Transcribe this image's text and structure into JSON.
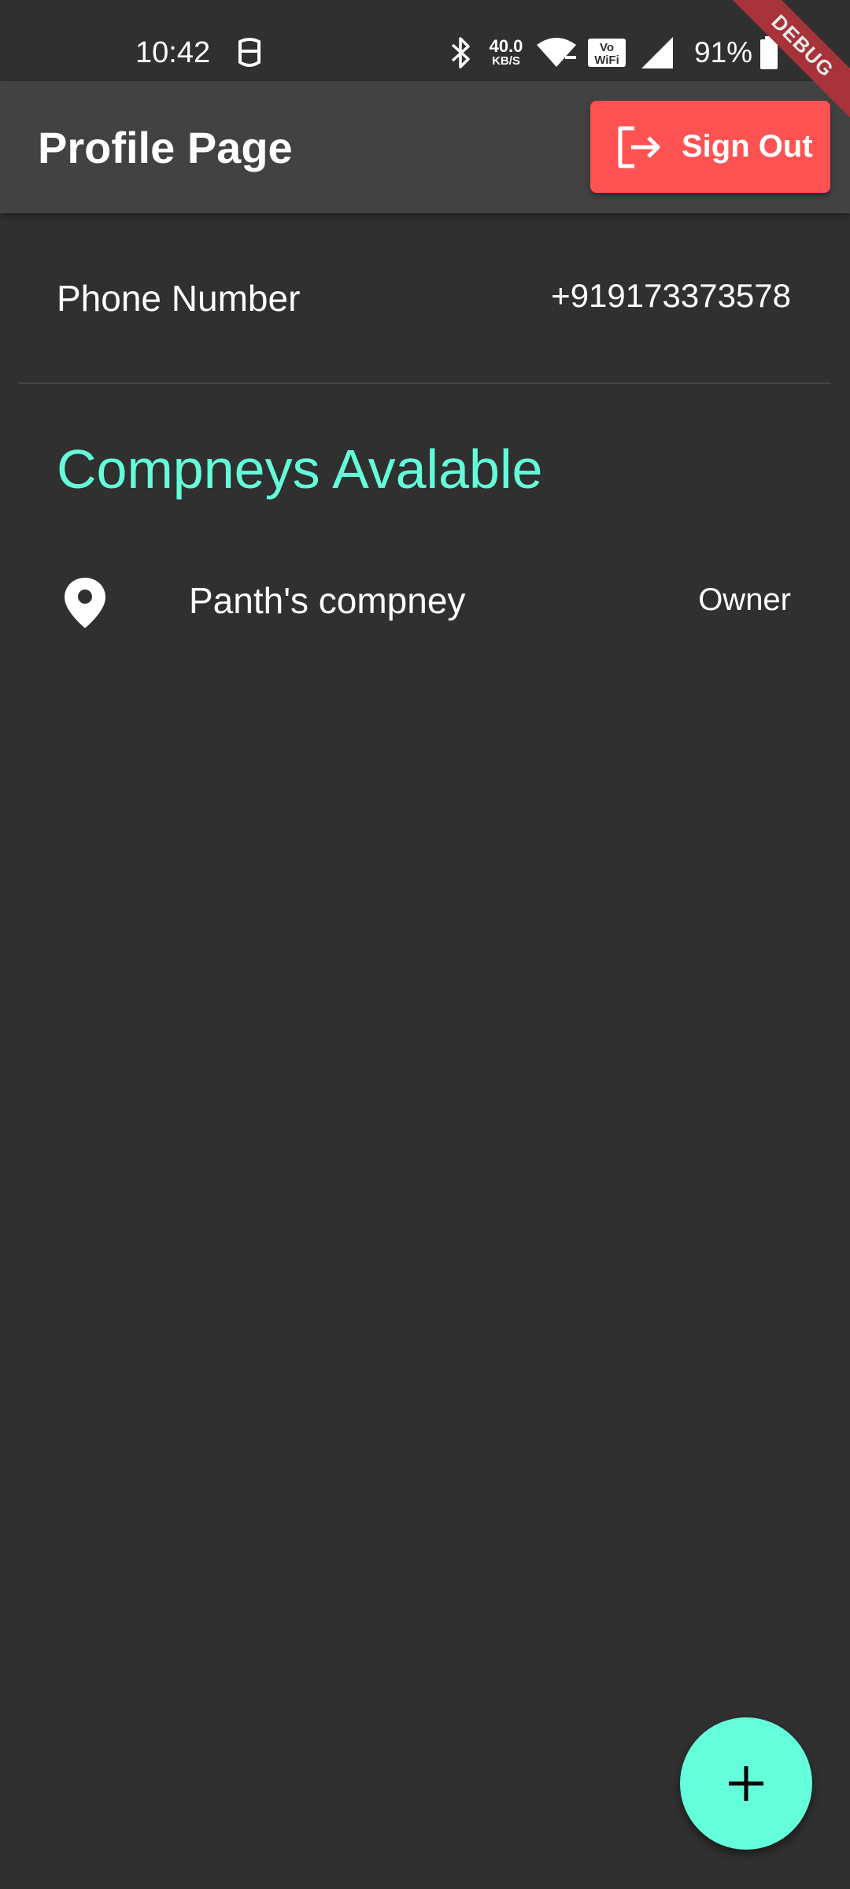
{
  "status_bar": {
    "time": "10:42",
    "net_speed_value": "40.0",
    "net_speed_unit": "KB/S",
    "battery_percent": "91%",
    "icons": [
      "notification-icon",
      "bluetooth-icon",
      "wifi-icon",
      "vowifi-icon",
      "signal-icon",
      "battery-icon"
    ]
  },
  "debug_banner": "DEBUG",
  "app_bar": {
    "title": "Profile Page",
    "sign_out_label": "Sign Out",
    "sign_out_icon": "logout-icon"
  },
  "profile": {
    "phone_label": "Phone Number",
    "phone_value": "+919173373578"
  },
  "companies": {
    "heading": "Compneys Avalable",
    "items": [
      {
        "icon": "location-pin-icon",
        "name": "Panth's compney",
        "role": "Owner"
      }
    ]
  },
  "fab": {
    "icon": "add-icon"
  },
  "colors": {
    "background": "#303030",
    "app_bar": "#424242",
    "accent": "#64ffda",
    "sign_out": "#ff5252",
    "debug_banner": "#a8323a"
  }
}
